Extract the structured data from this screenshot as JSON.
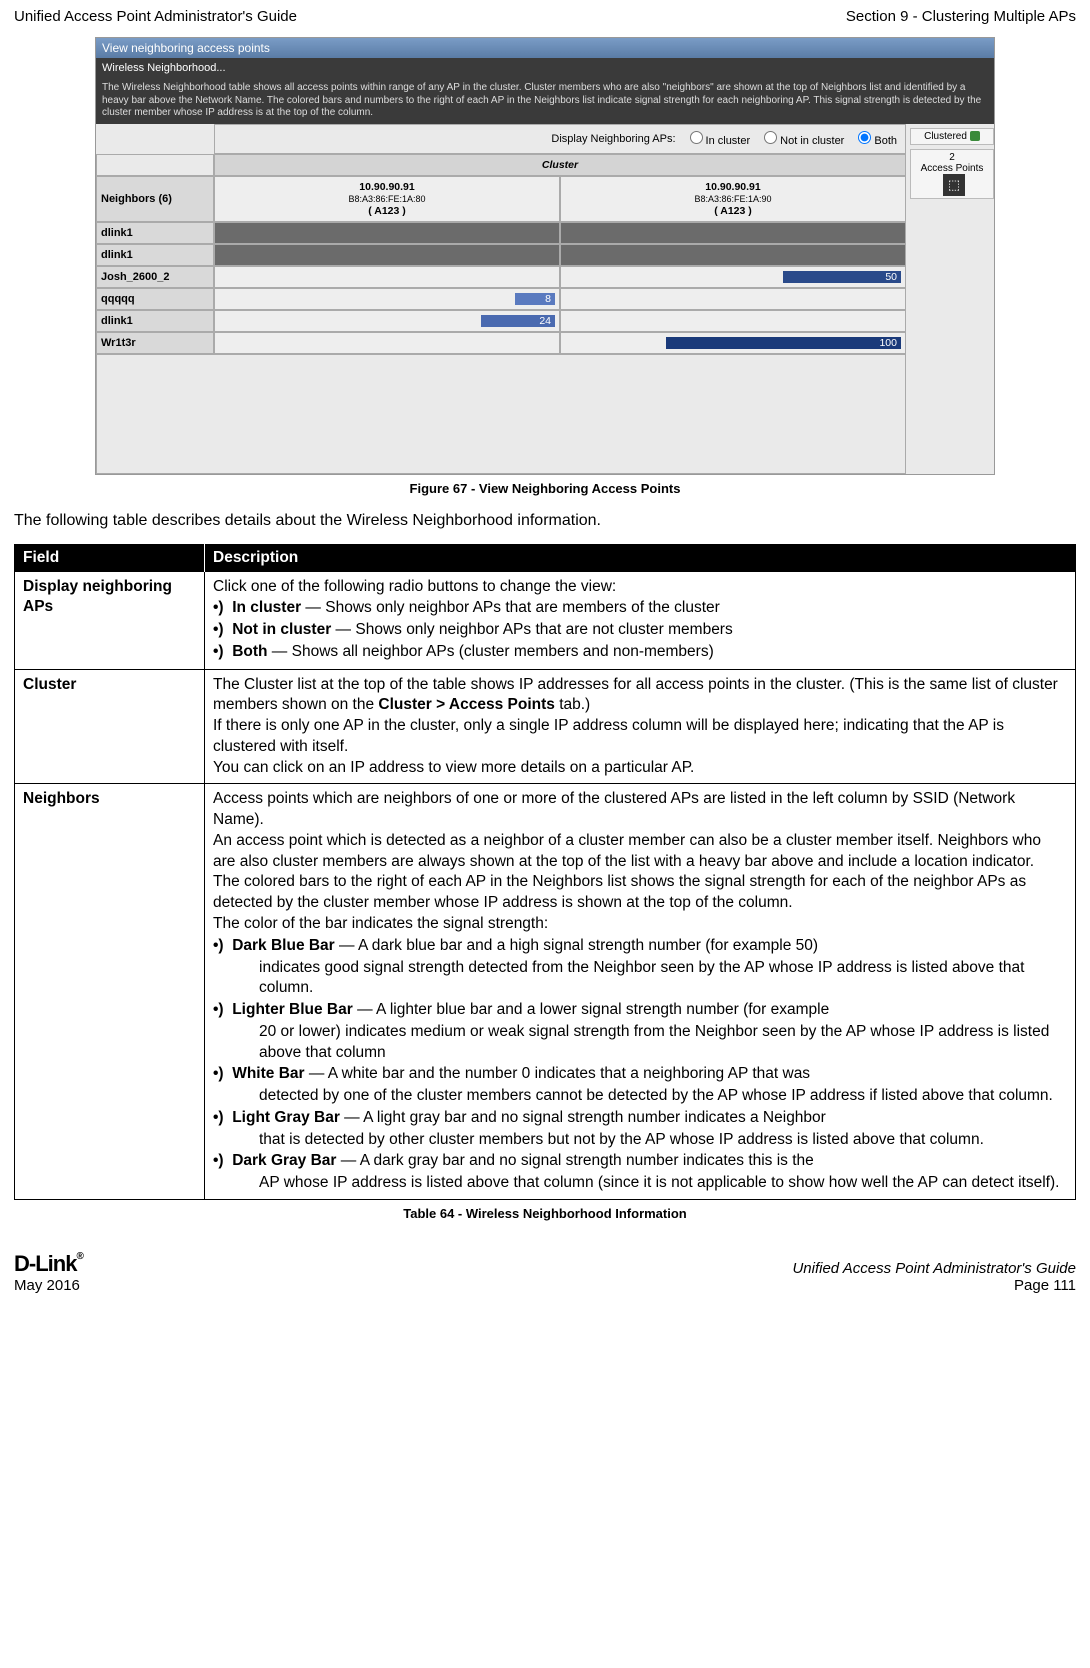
{
  "header": {
    "left": "Unified Access Point Administrator's Guide",
    "right": "Section 9 - Clustering Multiple APs"
  },
  "screenshot": {
    "title": "View neighboring access points",
    "subtitle": "Wireless Neighborhood...",
    "description": "The Wireless Neighborhood table shows all access points within range of any AP in the cluster. Cluster members who are also \"neighbors\" are shown at the top of Neighbors list and identified by a heavy bar above the Network Name. The colored bars and numbers to the right of each AP in the Neighbors list indicate signal strength for each neighboring AP. This signal strength is detected by the cluster member whose IP address is at the top of the column.",
    "controls_label": "Display Neighboring APs:",
    "radio_in": "In cluster",
    "radio_not": "Not in cluster",
    "radio_both": "Both",
    "clustered": "Clustered",
    "ap_count": "2",
    "ap_label": "Access Points",
    "cluster_header": "Cluster",
    "col1_ip": "10.90.90.91",
    "col1_mac": "B8:A3:86:FE:1A:80",
    "col1_sub": "( A123 )",
    "col2_ip": "10.90.90.91",
    "col2_mac": "B8:A3:86:FE:1A:90",
    "col2_sub": "( A123 )",
    "neighbors_header": "Neighbors (6)",
    "rows": [
      "dlink1",
      "dlink1",
      "Josh_2600_2",
      "qqqqq",
      "dlink1",
      "Wr1t3r"
    ]
  },
  "figure_caption": "Figure 67 - View Neighboring Access Points",
  "intro": "The following table describes details about the Wireless Neighborhood information.",
  "table": {
    "head_field": "Field",
    "head_desc": "Description",
    "r1_field": "Display neighboring APs",
    "r1_lead": "Click one of the following radio buttons to change the view:",
    "r1_b1": "•)  In cluster — Shows only neighbor APs that are members of the cluster",
    "r1_b2": "•)  Not in cluster — Shows only neighbor APs that are not cluster members",
    "r1_b3": "•)  Both — Shows all neighbor APs (cluster members and non-members)",
    "r2_field": "Cluster",
    "r2_p1": "The Cluster list at the top of the table shows IP addresses for all access points in the cluster. (This is the same list of cluster members shown on the Cluster > Access Points tab.)",
    "r2_p2": "If there is only one AP in the cluster, only a single IP address column will be displayed here; indicating that the AP is clustered with itself.",
    "r2_p3": "You can click on an IP address to view more details on a particular AP.",
    "r3_field": "Neighbors",
    "r3_p1": "Access points which are neighbors of one or more of the clustered APs are listed in the left column by SSID (Network Name).",
    "r3_p2": "An access point which is detected as a neighbor of a cluster member can also be a cluster member itself. Neighbors who are also cluster members are always shown at the top of the list with a heavy bar above and include a location indicator.",
    "r3_p3": "The colored bars to the right of each AP in the Neighbors list shows the signal strength for each of the neighbor APs as detected by the cluster member whose IP address is shown at the top of the column.",
    "r3_p4": "The color of the bar indicates the signal strength:",
    "r3_b1a": "•)  Dark Blue Bar — A dark blue bar and a high signal strength number (for example 50)",
    "r3_b1b": "indicates good signal strength detected from the Neighbor seen by the AP whose IP address is listed above that column.",
    "r3_b2a": "•)  Lighter Blue Bar — A lighter blue bar and a lower signal strength number (for example",
    "r3_b2b": "20 or lower) indicates medium or weak signal strength from the Neighbor seen by the AP whose IP address is listed above that column",
    "r3_b3a": "•)  White Bar — A white bar and the number 0 indicates that a neighboring AP that was",
    "r3_b3b": "detected by one of the cluster members cannot be detected by the AP whose IP address if listed above that column.",
    "r3_b4a": "•)  Light Gray Bar — A light gray bar and no signal strength number indicates a Neighbor",
    "r3_b4b": "that is detected by other cluster members but not by the AP whose IP address is listed above that column.",
    "r3_b5a": "•)  Dark Gray Bar — A dark gray bar and no signal strength number indicates this is the",
    "r3_b5b": "AP whose IP address is listed above that column (since it is not applicable to show how well the AP can detect itself)."
  },
  "table_caption": "Table 64 - Wireless Neighborhood Information",
  "footer": {
    "logo": "D-Link",
    "date": "May 2016",
    "right1": "Unified Access Point Administrator's Guide",
    "right2": "Page 111"
  }
}
